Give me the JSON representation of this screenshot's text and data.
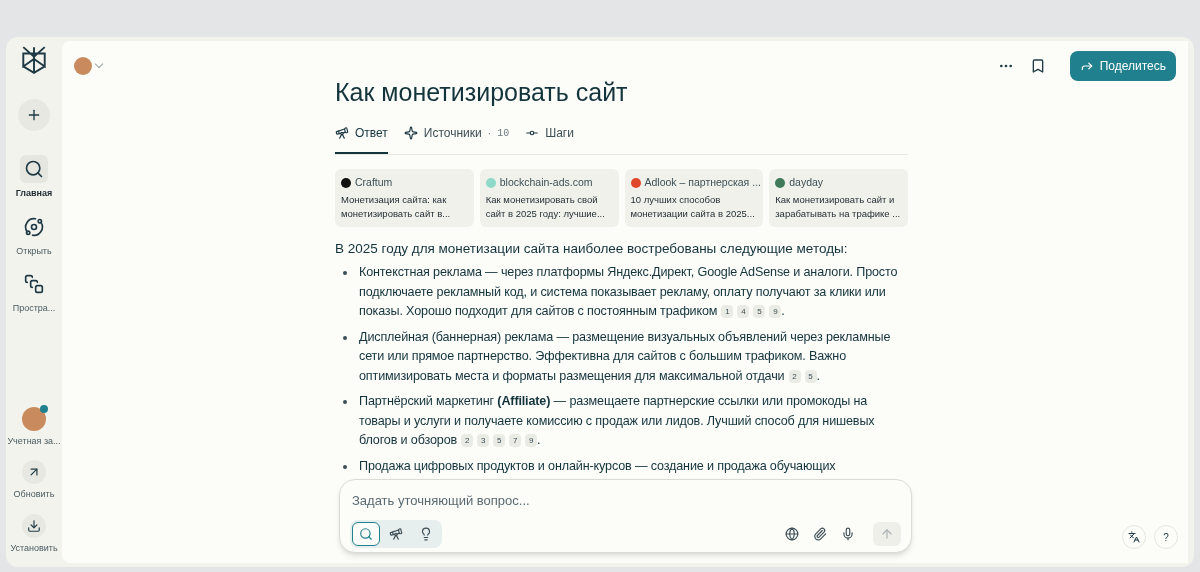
{
  "sidebar": {
    "nav": [
      {
        "kind": "home",
        "label": "Главная",
        "selected": true
      },
      {
        "kind": "discover",
        "label": "Открыть",
        "selected": false
      },
      {
        "kind": "spaces",
        "label": "Простра...",
        "selected": false
      }
    ],
    "bottom": [
      {
        "kind": "account",
        "label": "Учетная за..."
      },
      {
        "kind": "update",
        "label": "Обновить"
      },
      {
        "kind": "install",
        "label": "Установить"
      }
    ]
  },
  "header": {
    "share": "Поделитесь"
  },
  "help": "?",
  "title": "Как монетизировать сайт",
  "tabs": [
    {
      "kind": "answer",
      "label": "Ответ",
      "selected": true
    },
    {
      "kind": "sources",
      "label": "Источники",
      "separator": "·",
      "count": "10",
      "selected": false
    },
    {
      "kind": "steps",
      "label": "Шаги",
      "selected": false
    }
  ],
  "sources": [
    {
      "site": "Craftum",
      "title": "Монетизация сайта: как монетизировать сайт в...",
      "color": "#111111"
    },
    {
      "site": "blockchain-ads.com",
      "title": "Как монетизировать свой сайт в 2025 году: лучшие...",
      "color": "#8fd9c8"
    },
    {
      "site": "Adlook – партнерская ...",
      "title": "10 лучших способов монетизации сайта в 2025...",
      "color": "#e0482a"
    },
    {
      "site": "dayday",
      "title": "Как монетизировать сайт и зарабатывать на трафике ...",
      "color": "#3f7a5a"
    }
  ],
  "answer": {
    "intro": "В 2025 году для монетизации сайта наиболее востребованы следующие методы:",
    "items": [
      {
        "text": "Контекстная реклама — через платформы Яндекс.Директ, Google AdSense и аналоги. Просто подключаете рекламный код, и система показывает рекламу, оплату получают за клики или показы. Хорошо подходит для сайтов с постоянным трафиком",
        "citations": [
          "1",
          "4",
          "5",
          "9"
        ],
        "end": "."
      },
      {
        "text": "Дисплейная (баннерная) реклама — размещение визуальных объявлений через рекламные сети или прямое партнерство. Эффективна для сайтов с большим трафиком. Важно оптимизировать места и форматы размещения для максимальной отдачи",
        "citations": [
          "2",
          "5"
        ],
        "end": "."
      },
      {
        "text": "Партнёрский маркетинг **(Affiliate)** — размещаете партнерские ссылки или промокоды на товары и услуги и получаете комиссию с продаж или лидов. Лучший способ для нишевых блогов и обзоров",
        "citations": [
          "2",
          "3",
          "5",
          "7",
          "9"
        ],
        "end": "."
      },
      {
        "text": "Продажа цифровых продуктов и онлайн-курсов — создание и продажа обучающих"
      }
    ]
  },
  "composer": {
    "placeholder": "Задать уточняющий вопрос...",
    "modes": [
      {
        "kind": "search",
        "selected": true
      },
      {
        "kind": "research",
        "selected": false
      },
      {
        "kind": "labs",
        "selected": false
      }
    ]
  }
}
